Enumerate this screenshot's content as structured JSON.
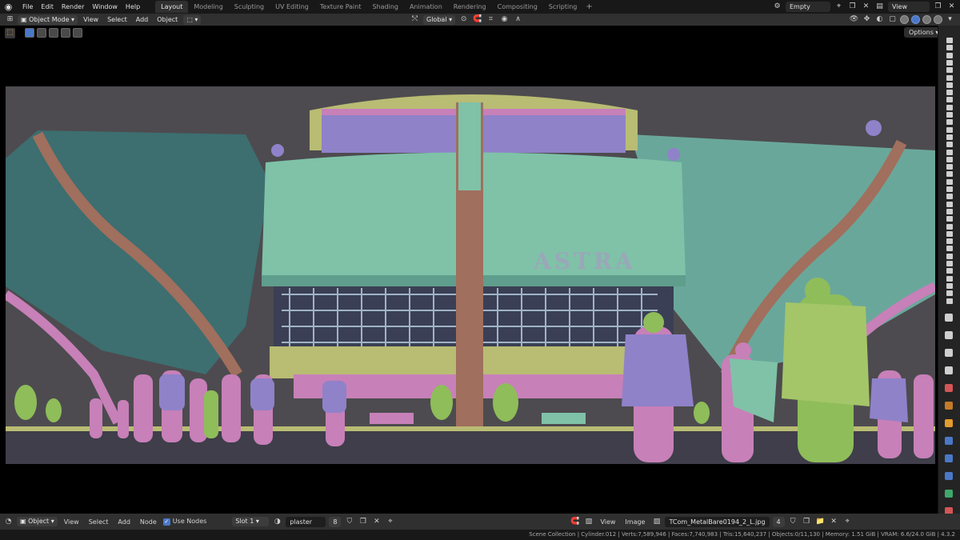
{
  "topbar": {
    "menus": [
      "File",
      "Edit",
      "Render",
      "Window",
      "Help"
    ],
    "workspaces": [
      "Layout",
      "Modeling",
      "Sculpting",
      "UV Editing",
      "Texture Paint",
      "Shading",
      "Animation",
      "Rendering",
      "Compositing",
      "Scripting"
    ],
    "active_workspace": "Layout",
    "scene": "Empty",
    "view_layer": "View Layer"
  },
  "viewport_header": {
    "mode": "Object Mode",
    "menus": [
      "View",
      "Select",
      "Add",
      "Object"
    ],
    "transform_orientation": "Global",
    "options_label": "Options"
  },
  "render": {
    "sign_text": "ASTRA",
    "palette": {
      "teal": "#7fc2a8",
      "purple": "#8f82c9",
      "pink": "#c780b8",
      "olive": "#b9bc73",
      "copper": "#a06f5d",
      "green": "#8fbd5a",
      "sky": "#4d4b4f"
    }
  },
  "node_header": {
    "object_type": "Object",
    "menus": [
      "View",
      "Select",
      "Add",
      "Node"
    ],
    "use_nodes_label": "Use Nodes",
    "slot": "Slot 1",
    "material": "plaster",
    "material_users": "8",
    "image_menus": [
      "View",
      "Image"
    ],
    "image_name": "TCom_MetalBare0194_2_L.jpg",
    "image_users": "4"
  },
  "status_bar": {
    "text": "Scene Collection | Cylinder.012 | Verts:7,589,946 | Faces:7,740,983 | Tris:15,640,237 | Objects:0/11,130 | Memory: 1.51 GiB | VRAM: 6.6/24.0 GiB | 4.3.2"
  }
}
